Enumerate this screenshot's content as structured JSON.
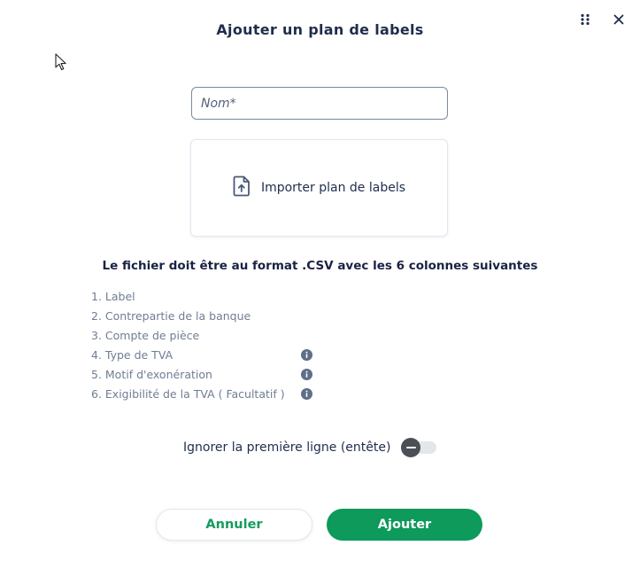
{
  "dialog": {
    "title": "Ajouter un plan de labels"
  },
  "header_icons": {
    "drag": "drag-handle-icon",
    "close": "close-icon"
  },
  "name_field": {
    "placeholder": "Nom*",
    "value": ""
  },
  "import": {
    "label": "Importer plan de labels",
    "icon": "file-upload-icon"
  },
  "format": {
    "heading": "Le fichier doit être au format .CSV avec les 6 colonnes suivantes",
    "columns": [
      {
        "label": "1. Label",
        "has_info": false
      },
      {
        "label": "2. Contrepartie de la banque",
        "has_info": false
      },
      {
        "label": "3. Compte de pièce",
        "has_info": false
      },
      {
        "label": "4. Type de TVA",
        "has_info": true
      },
      {
        "label": "5. Motif d'exonération",
        "has_info": true
      },
      {
        "label": "6. Exigibilité de la TVA ( Facultatif )",
        "has_info": true
      }
    ]
  },
  "ignore_header": {
    "label": "Ignorer la première ligne (entête)",
    "enabled": false
  },
  "buttons": {
    "cancel": "Annuler",
    "add": "Ajouter"
  },
  "colors": {
    "primary_green": "#0d9a5b",
    "text_dark": "#1f2d4d",
    "text_muted": "#6f7d93"
  }
}
